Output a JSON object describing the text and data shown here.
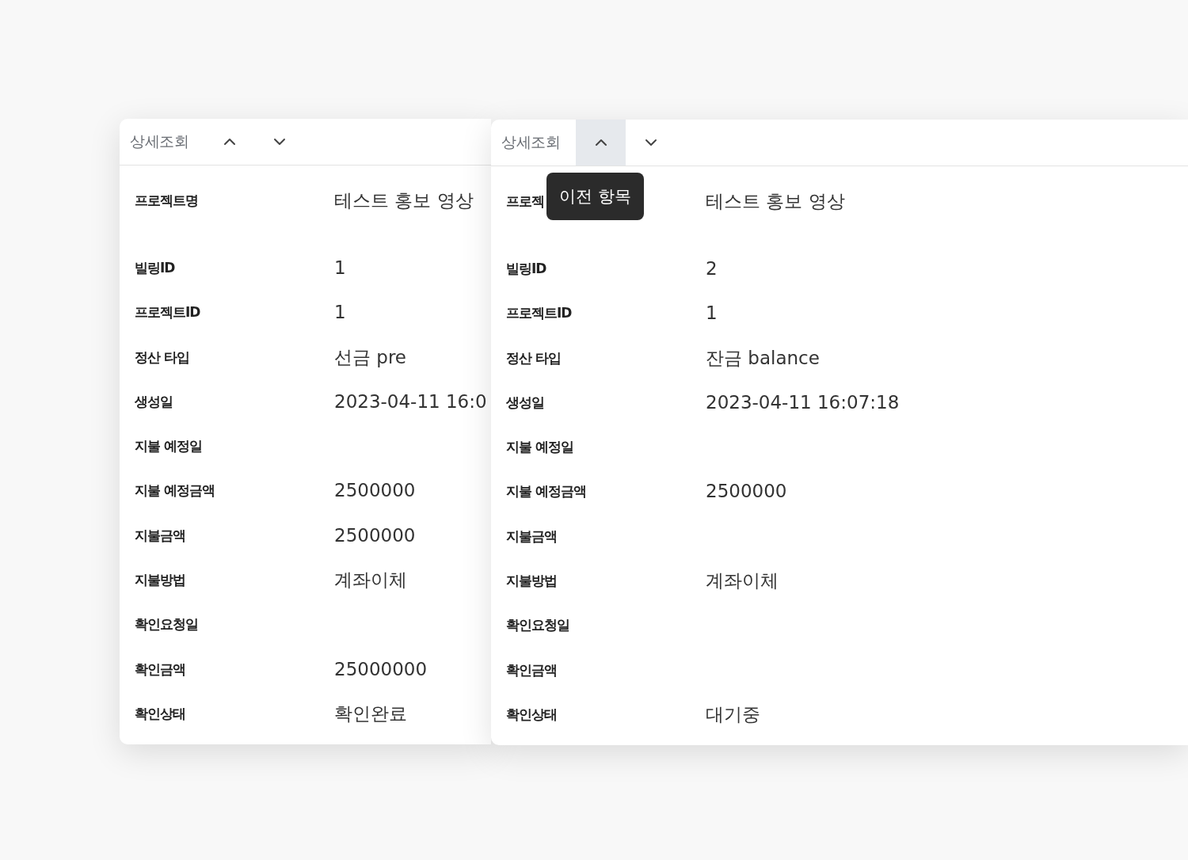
{
  "panels": [
    {
      "title": "상세조회",
      "prev_highlighted": false,
      "rows": [
        {
          "label": "프로젝트명",
          "value": "테스트 홍보 영상"
        },
        {
          "label": "빌링ID",
          "value": "1"
        },
        {
          "label": "프로젝트ID",
          "value": "1"
        },
        {
          "label": "정산 타입",
          "value": "선금 pre"
        },
        {
          "label": "생성일",
          "value": "2023-04-11 16:0"
        },
        {
          "label": "지불 예정일",
          "value": ""
        },
        {
          "label": "지불 예정금액",
          "value": "2500000"
        },
        {
          "label": "지불금액",
          "value": "2500000"
        },
        {
          "label": "지불방법",
          "value": "계좌이체"
        },
        {
          "label": "확인요청일",
          "value": ""
        },
        {
          "label": "확인금액",
          "value": "25000000"
        },
        {
          "label": "확인상태",
          "value": "확인완료"
        }
      ]
    },
    {
      "title": "상세조회",
      "prev_highlighted": true,
      "tooltip": "이전 항목",
      "rows": [
        {
          "label": "프로젝",
          "value": "테스트 홍보 영상"
        },
        {
          "label": "빌링ID",
          "value": "2"
        },
        {
          "label": "프로젝트ID",
          "value": "1"
        },
        {
          "label": "정산 타입",
          "value": "잔금 balance"
        },
        {
          "label": "생성일",
          "value": "2023-04-11 16:07:18"
        },
        {
          "label": "지불 예정일",
          "value": ""
        },
        {
          "label": "지불 예정금액",
          "value": "2500000"
        },
        {
          "label": "지불금액",
          "value": ""
        },
        {
          "label": "지불방법",
          "value": "계좌이체"
        },
        {
          "label": "확인요청일",
          "value": ""
        },
        {
          "label": "확인금액",
          "value": ""
        },
        {
          "label": "확인상태",
          "value": "대기중"
        }
      ]
    }
  ]
}
